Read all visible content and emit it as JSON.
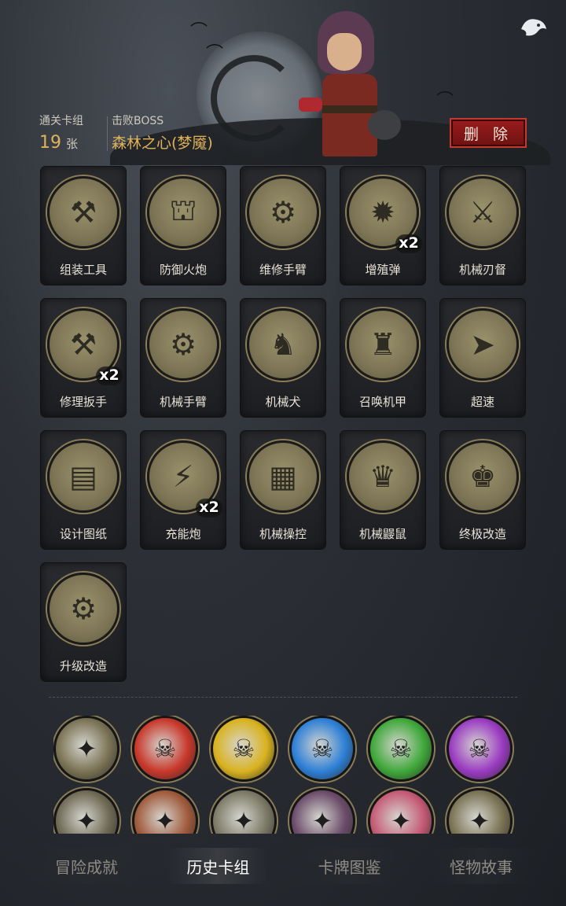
{
  "header": {
    "cleared_deck_label": "通关卡组",
    "card_count_value": "19",
    "card_count_unit": "张",
    "boss_label": "击败BOSS",
    "boss_name": "森林之心(梦魇)",
    "delete_label": "删 除"
  },
  "icons": {
    "settings": "ghost-wing-icon",
    "hero": "hooded-hero-portrait"
  },
  "cards": [
    {
      "label": "组装工具",
      "count": "",
      "icon": "tools"
    },
    {
      "label": "防御火炮",
      "count": "",
      "icon": "cannon"
    },
    {
      "label": "维修手臂",
      "count": "",
      "icon": "mech-arm"
    },
    {
      "label": "增殖弹",
      "count": "x2",
      "icon": "bomb"
    },
    {
      "label": "机械刃督",
      "count": "",
      "icon": "blade"
    },
    {
      "label": "修理扳手",
      "count": "x2",
      "icon": "wrench"
    },
    {
      "label": "机械手臂",
      "count": "",
      "icon": "robot-arms"
    },
    {
      "label": "机械犬",
      "count": "",
      "icon": "mech-dog"
    },
    {
      "label": "召唤机甲",
      "count": "",
      "icon": "mech-suit"
    },
    {
      "label": "超速",
      "count": "",
      "icon": "speed"
    },
    {
      "label": "设计图纸",
      "count": "",
      "icon": "blueprint"
    },
    {
      "label": "充能炮",
      "count": "x2",
      "icon": "charge-cannon"
    },
    {
      "label": "机械操控",
      "count": "",
      "icon": "control-panel"
    },
    {
      "label": "机械鼹鼠",
      "count": "",
      "icon": "mech-mole"
    },
    {
      "label": "终极改造",
      "count": "",
      "icon": "ultimate-mech"
    },
    {
      "label": "升级改造",
      "count": "",
      "icon": "upgrade"
    }
  ],
  "relics_row1": [
    {
      "icon": "torch-relic",
      "color": "#7a7254"
    },
    {
      "icon": "red-skull-relic",
      "color": "#c8372a"
    },
    {
      "icon": "yellow-skull-relic",
      "color": "#d9b21f"
    },
    {
      "icon": "blue-skull-relic",
      "color": "#2d7fd6"
    },
    {
      "icon": "green-skull-relic",
      "color": "#3fa83a"
    },
    {
      "icon": "purple-skull-relic",
      "color": "#9a3bc2"
    }
  ],
  "relics_row2": [
    {
      "icon": "gear-relic",
      "color": "#6f6a54"
    },
    {
      "icon": "bloody-hands-relic",
      "color": "#a05a3c"
    },
    {
      "icon": "soldiers-relic",
      "color": "#7c7a66"
    },
    {
      "icon": "vampire-relic",
      "color": "#6b4c6a"
    },
    {
      "icon": "pink-creature-relic",
      "color": "#c45a74"
    },
    {
      "icon": "sword-relic",
      "color": "#7a7254"
    }
  ],
  "tabs": [
    {
      "label": "冒险成就",
      "active": false
    },
    {
      "label": "历史卡组",
      "active": true
    },
    {
      "label": "卡牌图鉴",
      "active": false
    },
    {
      "label": "怪物故事",
      "active": false
    }
  ]
}
